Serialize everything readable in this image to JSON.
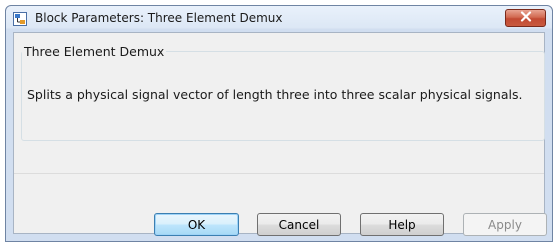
{
  "window": {
    "title": "Block Parameters: Three Element Demux",
    "icon": "simulink-block-icon",
    "close_icon": "close-icon"
  },
  "group": {
    "label": "Three Element Demux",
    "description": "Splits a physical signal vector of length three into three scalar physical signals."
  },
  "buttons": {
    "ok": "OK",
    "cancel": "Cancel",
    "help": "Help",
    "apply": "Apply"
  },
  "colors": {
    "close_button": "#c85a3f",
    "default_button_border": "#3c7fb1",
    "title_bar": "#dce7f5"
  }
}
